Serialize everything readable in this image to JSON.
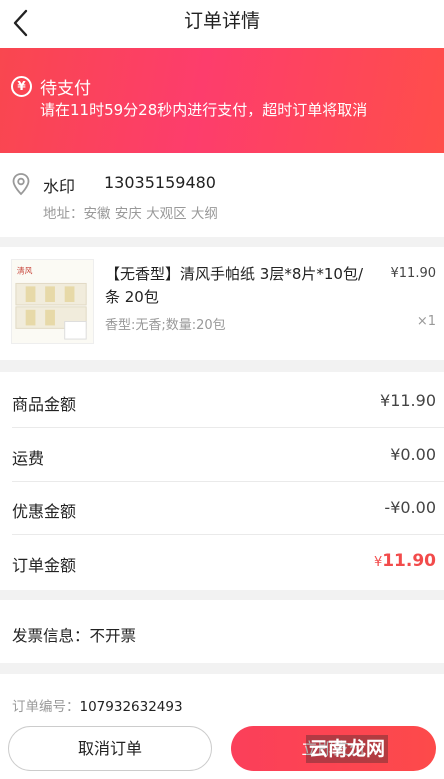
{
  "nav": {
    "title": "订单详情"
  },
  "banner": {
    "icon": "yen-icon",
    "status": "待支付",
    "tip": "请在11时59分28秒内进行支付，超时订单将取消",
    "colors": {
      "from": "#f9474f",
      "to": "#ff4e4a"
    }
  },
  "address": {
    "name": "水印",
    "phone": "13035159480",
    "detail": "地址：安徽 安庆 大观区 大纲"
  },
  "goods": {
    "name": "【无香型】清风手帕纸 3层*8片*10包/条 20包",
    "price": "¥11.90",
    "spec": "香型:无香;数量:20包",
    "qty": "×1"
  },
  "summary": {
    "rows": [
      {
        "label": "商品金额",
        "value": "¥11.90"
      },
      {
        "label": "运费",
        "value": "¥0.00"
      },
      {
        "label": "优惠金额",
        "value": "-¥0.00"
      }
    ],
    "total": {
      "label": "订单金额",
      "currency": "¥",
      "amount": "11.90",
      "color": "#f24b4b"
    }
  },
  "invoice": {
    "text": "发票信息：不开票"
  },
  "order": {
    "label": "订单编号：",
    "number": "107932632493"
  },
  "actions": {
    "cancel": "取消订单",
    "pay": "立即支付"
  },
  "watermark": "云南龙网"
}
